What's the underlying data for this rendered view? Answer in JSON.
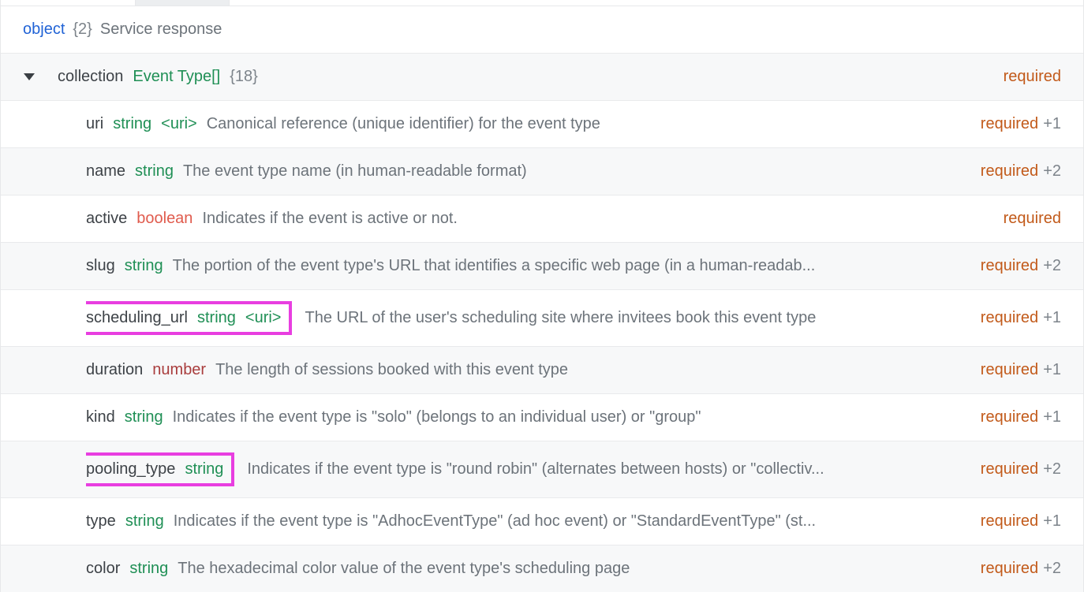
{
  "header": {
    "object_label": "object",
    "count": "{2}",
    "description": "Service response"
  },
  "collection_row": {
    "name": "collection",
    "type": "Event Type[]",
    "count": "{18}",
    "required": "required"
  },
  "props": [
    {
      "name": "uri",
      "type": "string",
      "type_class": "type-string",
      "format": "<uri>",
      "desc": "Canonical reference (unique identifier) for the event type",
      "required": "required",
      "extra": "+1",
      "alt": false,
      "highlight": false
    },
    {
      "name": "name",
      "type": "string",
      "type_class": "type-string",
      "format": "",
      "desc": "The event type name (in human-readable format)",
      "required": "required",
      "extra": "+2",
      "alt": true,
      "highlight": false
    },
    {
      "name": "active",
      "type": "boolean",
      "type_class": "type-bool",
      "format": "",
      "desc": "Indicates if the event is active or not.",
      "required": "required",
      "extra": "",
      "alt": false,
      "highlight": false
    },
    {
      "name": "slug",
      "type": "string",
      "type_class": "type-string",
      "format": "",
      "desc": "The portion of the event type's URL that identifies a specific web page (in a human-readab...",
      "required": "required",
      "extra": "+2",
      "alt": true,
      "highlight": false
    },
    {
      "name": "scheduling_url",
      "type": "string",
      "type_class": "type-string",
      "format": "<uri>",
      "desc": "The URL of the user's scheduling site where invitees book this event type",
      "required": "required",
      "extra": "+1",
      "alt": false,
      "highlight": true
    },
    {
      "name": "duration",
      "type": "number",
      "type_class": "type-number",
      "format": "",
      "desc": "The length of sessions booked with this event type",
      "required": "required",
      "extra": "+1",
      "alt": true,
      "highlight": false
    },
    {
      "name": "kind",
      "type": "string",
      "type_class": "type-string",
      "format": "",
      "desc": "Indicates if the event type is \"solo\" (belongs to an individual user) or \"group\"",
      "required": "required",
      "extra": "+1",
      "alt": false,
      "highlight": false
    },
    {
      "name": "pooling_type",
      "type": "string",
      "type_class": "type-string",
      "format": "",
      "desc": "Indicates if the event type is \"round robin\" (alternates between hosts) or \"collectiv...",
      "required": "required",
      "extra": "+2",
      "alt": true,
      "highlight": true
    },
    {
      "name": "type",
      "type": "string",
      "type_class": "type-string",
      "format": "",
      "desc": "Indicates if the event type is \"AdhocEventType\" (ad hoc event) or \"StandardEventType\" (st...",
      "required": "required",
      "extra": "+1",
      "alt": false,
      "highlight": false
    },
    {
      "name": "color",
      "type": "string",
      "type_class": "type-string",
      "format": "",
      "desc": "The hexadecimal color value of the event type's scheduling page",
      "required": "required",
      "extra": "+2",
      "alt": true,
      "highlight": false
    }
  ]
}
